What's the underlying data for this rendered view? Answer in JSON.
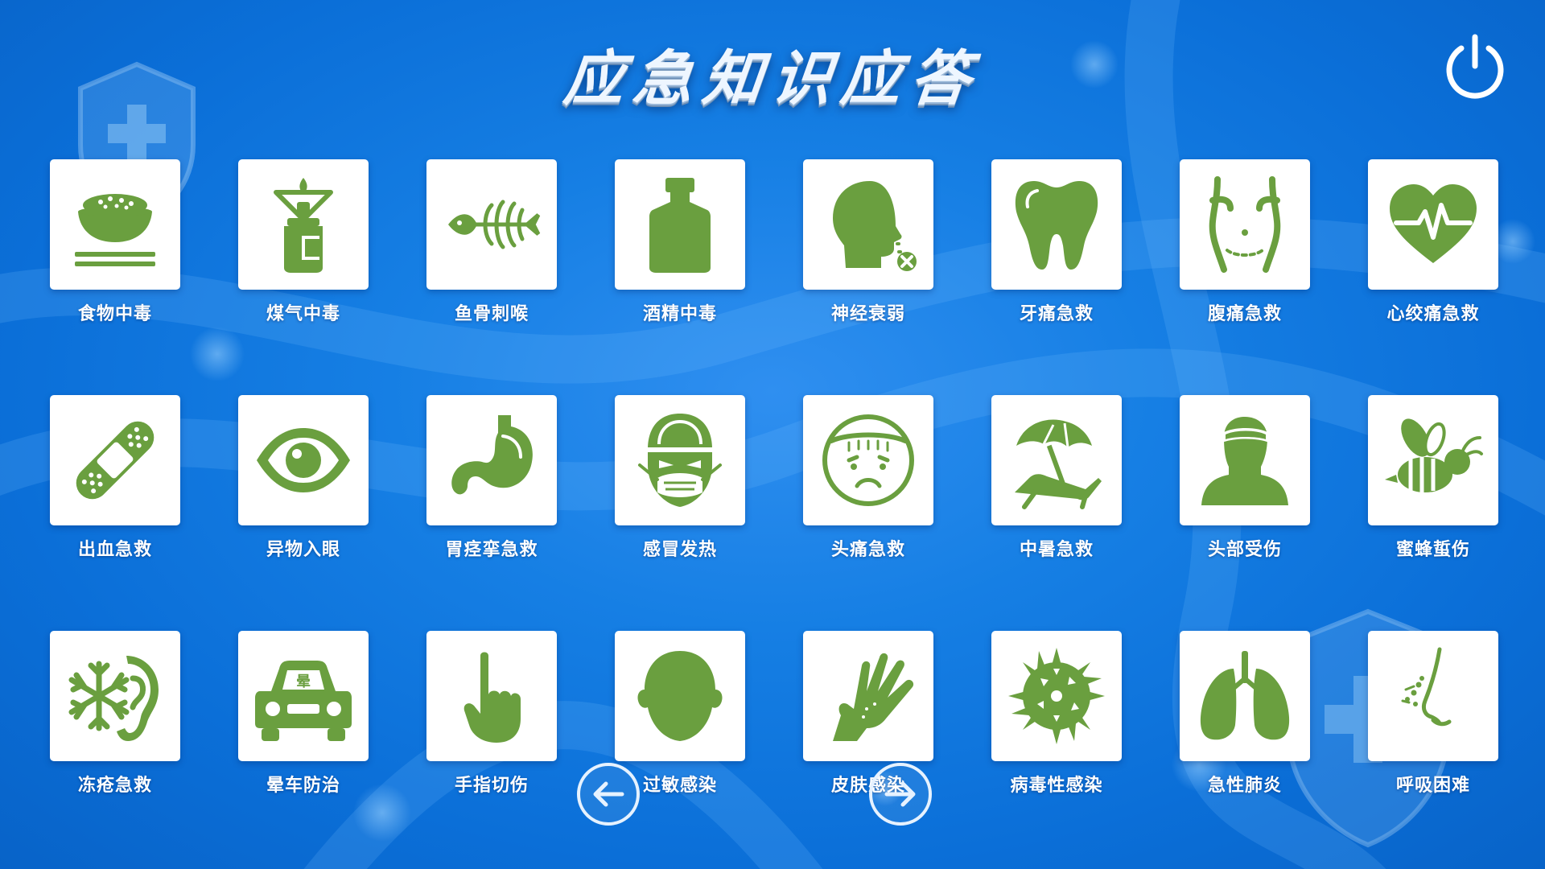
{
  "title": "应急知识应答",
  "colors": {
    "icon_green": "#6a9f3f",
    "tile_bg": "#ffffff",
    "background": "#167fe4"
  },
  "power_button": {
    "icon": "power-icon"
  },
  "tiles": [
    {
      "label": "食物中毒",
      "icon": "rice-bowl-icon"
    },
    {
      "label": "煤气中毒",
      "icon": "gas-stove-icon"
    },
    {
      "label": "鱼骨刺喉",
      "icon": "fish-bone-icon"
    },
    {
      "label": "酒精中毒",
      "icon": "alcohol-bottle-icon"
    },
    {
      "label": "神经衰弱",
      "icon": "head-profile-icon"
    },
    {
      "label": "牙痛急救",
      "icon": "tooth-icon"
    },
    {
      "label": "腹痛急救",
      "icon": "abdomen-icon"
    },
    {
      "label": "心绞痛急救",
      "icon": "heart-pulse-icon"
    },
    {
      "label": "出血急救",
      "icon": "bandage-icon"
    },
    {
      "label": "异物入眼",
      "icon": "eye-icon"
    },
    {
      "label": "胃痉挛急救",
      "icon": "stomach-icon"
    },
    {
      "label": "感冒发热",
      "icon": "masked-face-icon"
    },
    {
      "label": "头痛急救",
      "icon": "headache-face-icon"
    },
    {
      "label": "中暑急救",
      "icon": "beach-umbrella-icon"
    },
    {
      "label": "头部受伤",
      "icon": "head-injury-icon"
    },
    {
      "label": "蜜蜂蜇伤",
      "icon": "bee-icon"
    },
    {
      "label": "冻疮急救",
      "icon": "frostbite-ear-icon"
    },
    {
      "label": "晕车防治",
      "icon": "car-icon"
    },
    {
      "label": "手指切伤",
      "icon": "finger-icon"
    },
    {
      "label": "过敏感染",
      "icon": "bald-head-icon"
    },
    {
      "label": "皮肤感染",
      "icon": "hand-icon"
    },
    {
      "label": "病毒性感染",
      "icon": "virus-icon"
    },
    {
      "label": "急性肺炎",
      "icon": "lungs-icon"
    },
    {
      "label": "呼吸困难",
      "icon": "nose-breath-icon"
    }
  ],
  "car_plate_text": "晕",
  "nav": {
    "prev_icon": "arrow-left-icon",
    "next_icon": "arrow-right-icon"
  }
}
